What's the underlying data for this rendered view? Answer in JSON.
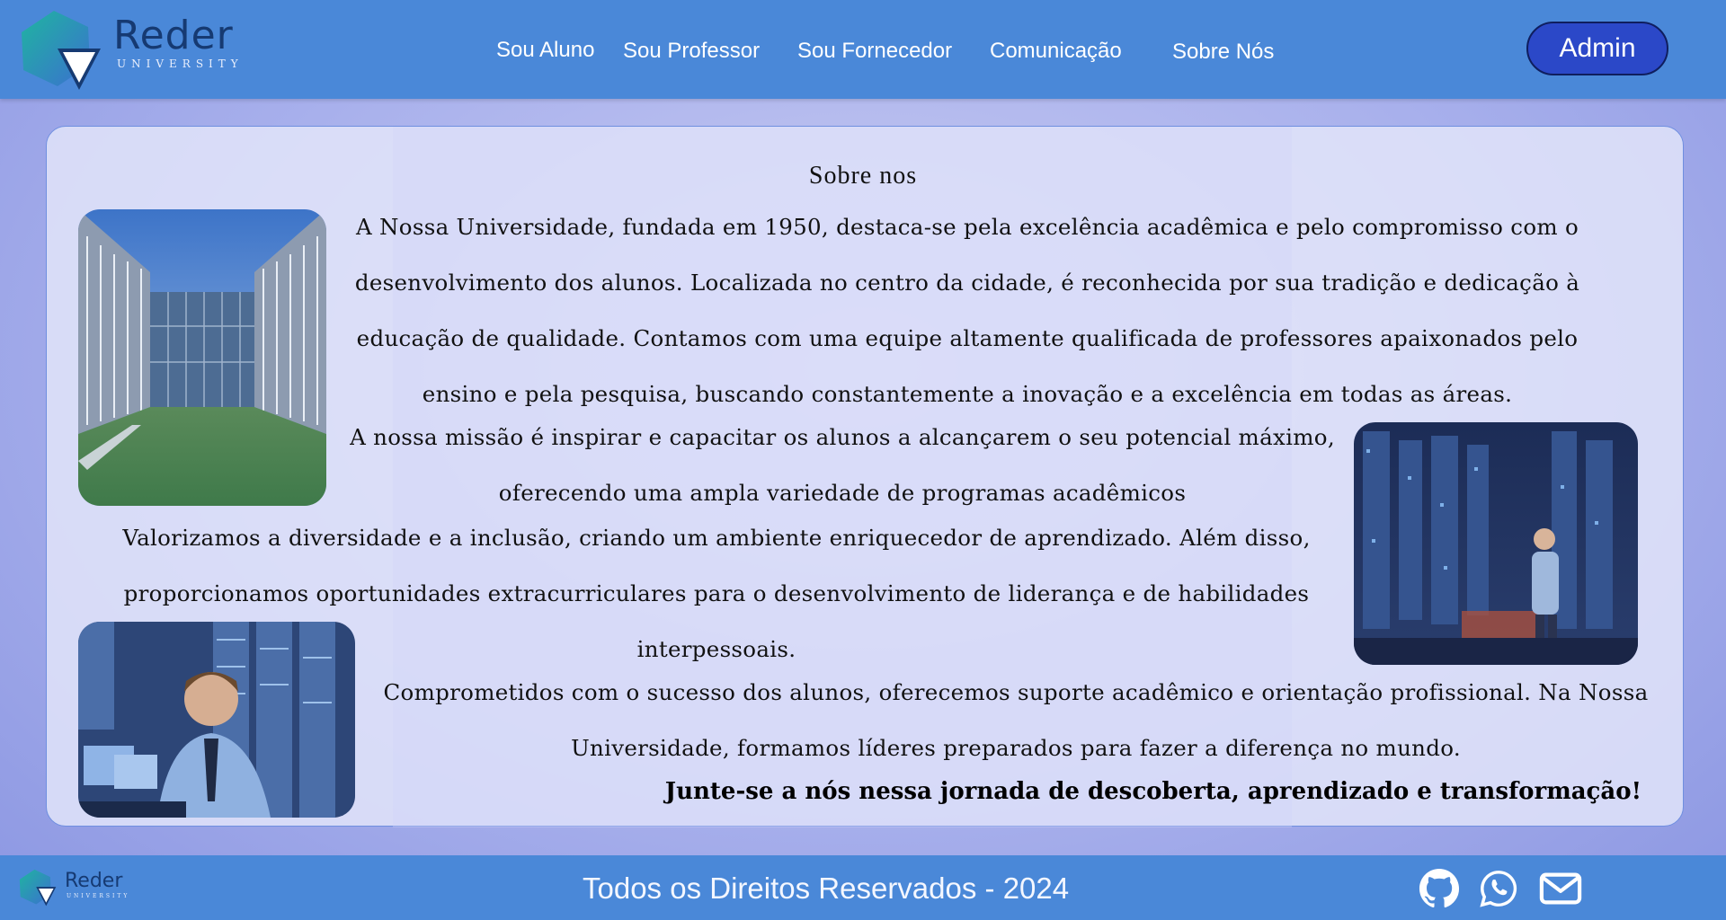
{
  "header": {
    "logo": {
      "name": "Reder",
      "sub": "UNIVERSITY"
    },
    "nav": [
      {
        "label": "Sou Aluno"
      },
      {
        "label": "Sou Professor"
      },
      {
        "label": "Sou Fornecedor"
      },
      {
        "label": "Comunicação"
      },
      {
        "label": "Sobre Nós"
      }
    ],
    "admin_label": "Admin"
  },
  "main": {
    "title": "Sobre nos",
    "paragraphs": [
      "A Nossa Universidade, fundada em 1950, destaca-se pela excelência acadêmica e pelo compromisso com o desenvolvimento dos alunos. Localizada no centro da cidade, é reconhecida por sua tradição e dedicação à educação de qualidade. Contamos com uma equipe altamente qualificada de professores apaixonados pelo ensino e pela pesquisa, buscando constantemente a inovação e a excelência em todas as áreas.",
      "A nossa missão é inspirar e capacitar os alunos a alcançarem o seu potencial máximo, oferecendo uma ampla variedade de programas acadêmicos",
      "Valorizamos a diversidade e a inclusão, criando um ambiente enriquecedor de aprendizado. Além disso, proporcionamos oportunidades extracurriculares para o desenvolvimento de liderança e de habilidades interpessoais.",
      "Comprometidos com o sucesso dos alunos, oferecemos suporte acadêmico e orientação profissional. Na Nossa Universidade, formamos líderes preparados para fazer a diferença no mundo."
    ],
    "closing": "Junte-se a nós nessa jornada de descoberta, aprendizado e transformação!"
  },
  "footer": {
    "logo": {
      "name": "Reder",
      "sub": "UNIVERSITY"
    },
    "copyright": "Todos os Direitos Reservados - 2024",
    "icons": [
      "github-icon",
      "whatsapp-icon",
      "mail-icon"
    ]
  },
  "colors": {
    "header_bg": "#4a88d8",
    "admin_bg": "#2b48c8",
    "logo_gradient_start": "#1fb5a0",
    "logo_gradient_end": "#3b6fd0"
  }
}
